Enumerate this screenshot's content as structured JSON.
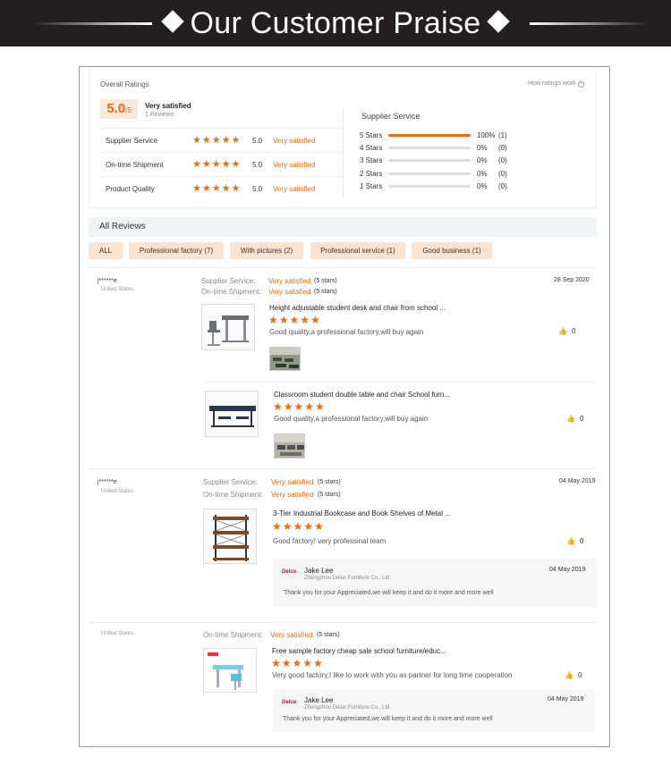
{
  "banner": {
    "title": "Our Customer Praise"
  },
  "overall": {
    "heading": "Overall Ratings",
    "how_link": "How ratings work",
    "score": "5.0",
    "score_max": "/5",
    "summary": "Very satisfied",
    "reviews_count": "1 Reviews",
    "rows": [
      {
        "label": "Supplier Service",
        "score": "5.0",
        "text": "Very satisfied"
      },
      {
        "label": "On-time Shipment",
        "score": "5.0",
        "text": "Very satisfied"
      },
      {
        "label": "Product Quality",
        "score": "5.0",
        "text": "Very satisfied"
      }
    ],
    "stars_text": "★★★★★"
  },
  "supplier": {
    "heading": "Supplier Service",
    "rows": [
      {
        "label": "5 Stars",
        "percent_text": "100%",
        "count": "(1)",
        "fill": 1.0
      },
      {
        "label": "4 Stars",
        "percent_text": "0%",
        "count": "(0)",
        "fill": 0
      },
      {
        "label": "3 Stars",
        "percent_text": "0%",
        "count": "(0)",
        "fill": 0
      },
      {
        "label": "2 Stars",
        "percent_text": "0%",
        "count": "(0)",
        "fill": 0
      },
      {
        "label": "1 Stars",
        "percent_text": "0%",
        "count": "(0)",
        "fill": 0
      }
    ]
  },
  "reviews": {
    "heading": "All Reviews",
    "filters": [
      "ALL",
      "Professional factory (7)",
      "With pictures (2)",
      "Professional service (1)",
      "Good business (1)"
    ],
    "labels": {
      "supplier_service": "Supplier Service:",
      "on_time": "On-time Shipment:",
      "very_satisfied": "Very satisfied",
      "five_stars": "(5 stars)",
      "like_count": "0"
    },
    "r1": {
      "user": "j******e",
      "country": "United States",
      "date": "28 Sep 2020",
      "p1_title": "Height adjustable student desk and chair from school ...",
      "p1_text": "Good quality,a professional factory,will buy again",
      "p2_title": "Classroom student double table and chair School furn...",
      "p2_text": "Good quality,a professional factory,will buy again"
    },
    "r2": {
      "user": "j******e",
      "country": "United States",
      "date": "04 May 2019",
      "p_title": "3-Tier Industrial Bookcase and Book Shelves of Metal ...",
      "p_text": "Good factory! very professinal team",
      "reply_name": "Jake Lee",
      "reply_company": "Zhengzhou Delux Furniture Co., Ltd.",
      "reply_date": "04 May 2019",
      "reply_text": "Thank you for your Appreciated,we will keep it and do it  more and more well"
    },
    "r3": {
      "country": "United States",
      "p_title": "Free sample factory cheap sale school furniture/educ...",
      "p_text": "Very good factory,I like to work with you as partner for long time cooperation",
      "reply_name": "Jake Lee",
      "reply_company": "Zhengzhou Delux Furniture Co., Ltd.",
      "reply_date": "04 May 2019",
      "reply_text": "Thank you for your Appreciated,we will keep it and do it  more and more well"
    },
    "logo_text": "Delux"
  },
  "colors": {
    "accent": "#f26a10",
    "chip": "#fde2cf",
    "banner": "#231f20"
  }
}
